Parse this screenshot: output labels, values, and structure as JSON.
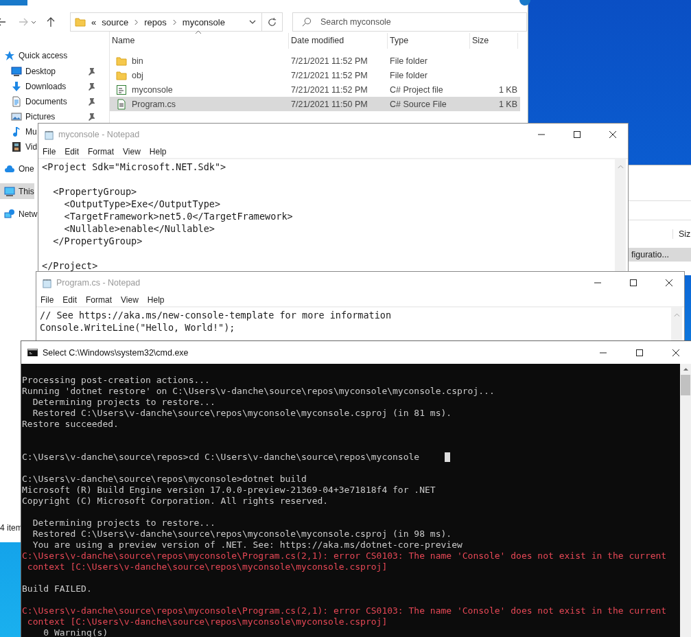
{
  "explorer": {
    "address": {
      "overflow": "«",
      "crumbs": [
        "source",
        "repos",
        "myconsole"
      ]
    },
    "search": {
      "placeholder": "Search myconsole"
    },
    "nav": [
      {
        "label": "Quick access",
        "kind": "star",
        "selected": false,
        "children": [
          {
            "label": "Desktop",
            "kind": "desktop",
            "pinned": true,
            "selected": false
          },
          {
            "label": "Downloads",
            "kind": "download",
            "pinned": true,
            "selected": false
          },
          {
            "label": "Documents",
            "kind": "document",
            "pinned": true,
            "selected": false
          },
          {
            "label": "Pictures",
            "kind": "picture",
            "pinned": true,
            "selected": false
          },
          {
            "label": "Mu",
            "kind": "music",
            "pinned": false,
            "selected": false
          },
          {
            "label": "Vid",
            "kind": "video",
            "pinned": false,
            "selected": false
          }
        ]
      },
      {
        "label": "One",
        "kind": "cloud",
        "selected": false
      },
      {
        "label": "This",
        "kind": "computer",
        "selected": true
      },
      {
        "label": "Netw",
        "kind": "network",
        "selected": false
      }
    ],
    "columns": [
      "Name",
      "Date modified",
      "Type",
      "Size"
    ],
    "rows": [
      {
        "name": "bin",
        "kind": "folder",
        "date": "7/21/2021 11:52 PM",
        "type": "File folder",
        "selected": false
      },
      {
        "name": "obj",
        "kind": "folder",
        "date": "7/21/2021 11:52 PM",
        "type": "File folder",
        "selected": false
      },
      {
        "name": "myconsole",
        "kind": "csproj",
        "date": "7/21/2021 11:52 PM",
        "type": "C# Project file",
        "size": "1 KB",
        "selected": false
      },
      {
        "name": "Program.cs",
        "kind": "source",
        "date": "7/21/2021 11:50 PM",
        "type": "C# Source File",
        "size": "1 KB",
        "selected": true
      }
    ],
    "status": "4 item"
  },
  "background_window": {
    "column": "Siz",
    "row": {
      "text": "figuratio...",
      "selected": true
    }
  },
  "notepads": [
    {
      "title": "myconsole - Notepad",
      "active": false,
      "menu": [
        "File",
        "Edit",
        "Format",
        "View",
        "Help"
      ],
      "lines": [
        {
          "kind": "text",
          "text": "<Project Sdk=\"Microsoft.NET.Sdk\">"
        },
        {
          "kind": "blank"
        },
        {
          "kind": "text",
          "text": "  <PropertyGroup>"
        },
        {
          "kind": "text",
          "text": "    <OutputType>Exe</OutputType>"
        },
        {
          "kind": "text",
          "text": "    <TargetFramework>net5.0</TargetFramework>"
        },
        {
          "kind": "text",
          "text": "    <Nullable>enable</Nullable>"
        },
        {
          "kind": "text",
          "text": "  </PropertyGroup>"
        },
        {
          "kind": "blank"
        },
        {
          "kind": "text",
          "text": "</Project>"
        }
      ]
    },
    {
      "title": "Program.cs - Notepad",
      "active": false,
      "menu": [
        "File",
        "Edit",
        "Format",
        "View",
        "Help"
      ],
      "lines": [
        {
          "kind": "text",
          "text": "// See https://aka.ms/new-console-template for more information"
        },
        {
          "kind": "text",
          "text": "Console.WriteLine(\"Hello, World!\");"
        }
      ]
    }
  ],
  "console": {
    "title": "Select C:\\Windows\\system32\\cmd.exe",
    "active": true,
    "lines": [
      {
        "kind": "blank"
      },
      {
        "kind": "normal",
        "text": "Processing post-creation actions..."
      },
      {
        "kind": "normal",
        "text": "Running 'dotnet restore' on C:\\Users\\v-danche\\source\\repos\\myconsole\\myconsole.csproj..."
      },
      {
        "kind": "normal",
        "text": "  Determining projects to restore..."
      },
      {
        "kind": "normal",
        "text": "  Restored C:\\Users\\v-danche\\source\\repos\\myconsole\\myconsole.csproj (in 81 ms)."
      },
      {
        "kind": "normal",
        "text": "Restore succeeded."
      },
      {
        "kind": "blank"
      },
      {
        "kind": "blank"
      },
      {
        "kind": "normal",
        "text": "C:\\Users\\v-danche\\source\\repos>cd C:\\Users\\v-danche\\source\\repos\\myconsole",
        "cursor": true
      },
      {
        "kind": "blank"
      },
      {
        "kind": "normal",
        "text": "C:\\Users\\v-danche\\source\\repos\\myconsole>dotnet build"
      },
      {
        "kind": "normal",
        "text": "Microsoft (R) Build Engine version 17.0.0-preview-21369-04+3e71818f4 for .NET"
      },
      {
        "kind": "normal",
        "text": "Copyright (C) Microsoft Corporation. All rights reserved."
      },
      {
        "kind": "blank"
      },
      {
        "kind": "normal",
        "text": "  Determining projects to restore..."
      },
      {
        "kind": "normal",
        "text": "  Restored C:\\Users\\v-danche\\source\\repos\\myconsole\\myconsole.csproj (in 98 ms)."
      },
      {
        "kind": "normal",
        "text": "  You are using a preview version of .NET. See: https://aka.ms/dotnet-core-preview"
      },
      {
        "kind": "error",
        "text": "C:\\Users\\v-danche\\source\\repos\\myconsole\\Program.cs(2,1): error CS0103: The name 'Console' does not exist in the current"
      },
      {
        "kind": "error",
        "text": " context [C:\\Users\\v-danche\\source\\repos\\myconsole\\myconsole.csproj]"
      },
      {
        "kind": "blank"
      },
      {
        "kind": "normal",
        "text": "Build FAILED."
      },
      {
        "kind": "blank"
      },
      {
        "kind": "error",
        "text": "C:\\Users\\v-danche\\source\\repos\\myconsole\\Program.cs(2,1): error CS0103: The name 'Console' does not exist in the current"
      },
      {
        "kind": "error",
        "text": " context [C:\\Users\\v-danche\\source\\repos\\myconsole\\myconsole.csproj]"
      },
      {
        "kind": "normal",
        "text": "    0 Warning(s)"
      }
    ]
  }
}
